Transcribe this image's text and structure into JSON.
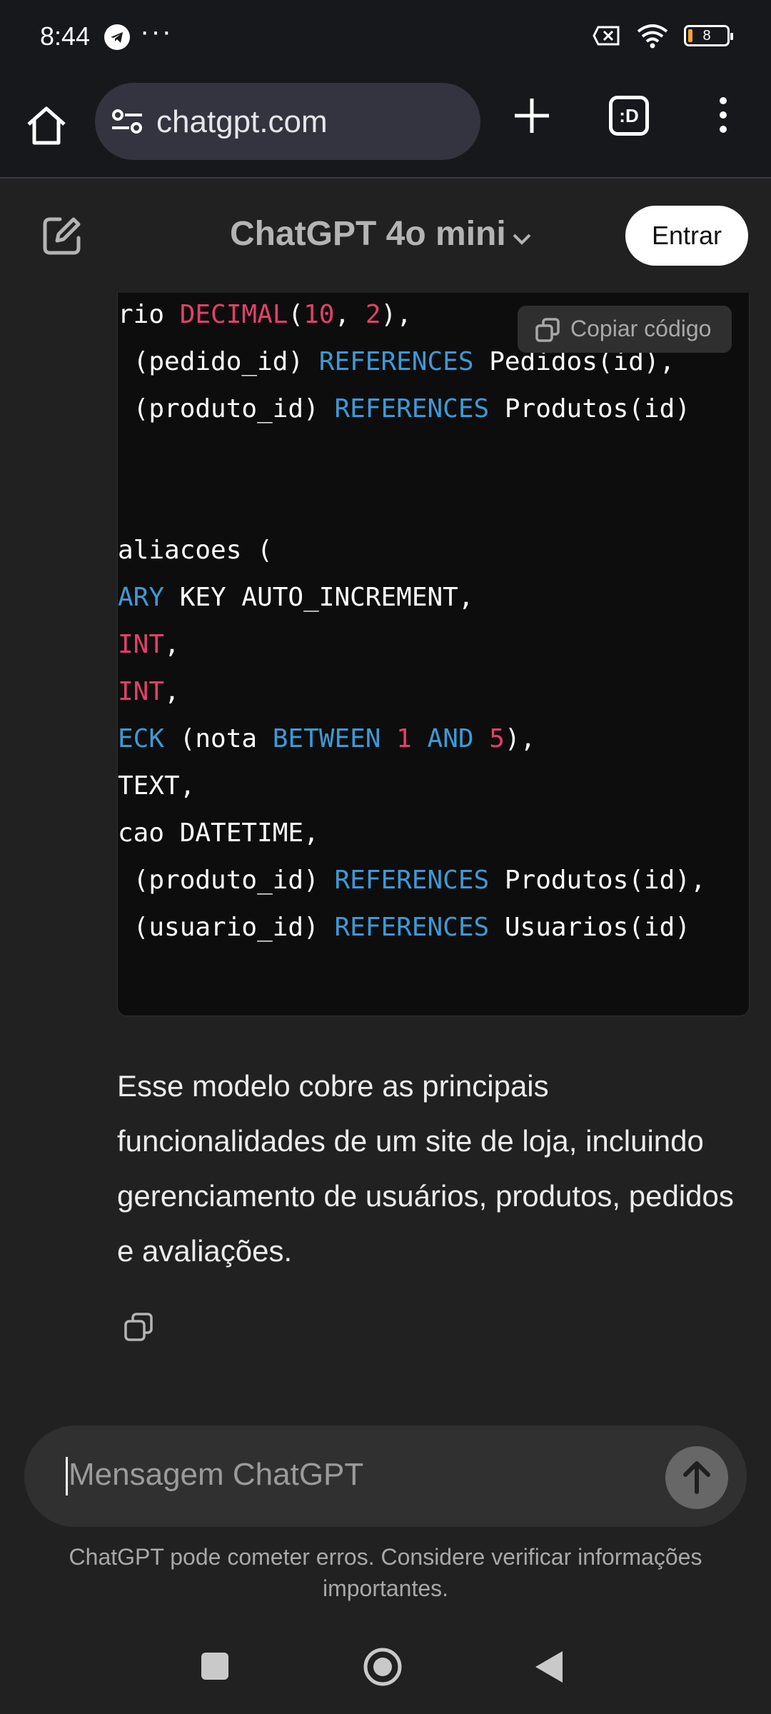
{
  "status_bar": {
    "time": "8:44",
    "dots": "···",
    "battery": "8",
    "icons": [
      "telegram-icon",
      "no-sim-icon",
      "wifi-icon",
      "battery-icon"
    ]
  },
  "browser": {
    "url": "chatgpt.com",
    "tabs_label": ":D",
    "icons": [
      "home-icon",
      "site-settings-icon",
      "new-tab-icon",
      "tabs-icon",
      "more-icon"
    ]
  },
  "header": {
    "model": "ChatGPT 4o mini",
    "login": "Entrar",
    "icons": [
      "new-chat-icon",
      "chevron-down-icon"
    ]
  },
  "code": {
    "copy_label": "Copiar código",
    "lines": [
      [
        {
          "t": "rio ",
          "c": ""
        },
        {
          "t": "DECIMAL",
          "c": "ty"
        },
        {
          "t": "(",
          "c": ""
        },
        {
          "t": "10",
          "c": "nu"
        },
        {
          "t": ", ",
          "c": ""
        },
        {
          "t": "2",
          "c": "nu"
        },
        {
          "t": "),",
          "c": ""
        }
      ],
      [
        {
          "t": " (pedido_id) ",
          "c": ""
        },
        {
          "t": "REFERENCES",
          "c": "kw"
        },
        {
          "t": " Pedidos(id),",
          "c": ""
        }
      ],
      [
        {
          "t": " (produto_id) ",
          "c": ""
        },
        {
          "t": "REFERENCES",
          "c": "kw"
        },
        {
          "t": " Produtos(id)",
          "c": ""
        }
      ],
      [],
      [],
      [
        {
          "t": "aliacoes (",
          "c": ""
        }
      ],
      [
        {
          "t": "ARY",
          "c": "kw"
        },
        {
          "t": " KEY AUTO_INCREMENT,",
          "c": ""
        }
      ],
      [
        {
          "t": "INT",
          "c": "ty"
        },
        {
          "t": ",",
          "c": ""
        }
      ],
      [
        {
          "t": "INT",
          "c": "ty"
        },
        {
          "t": ",",
          "c": ""
        }
      ],
      [
        {
          "t": "ECK",
          "c": "kw"
        },
        {
          "t": " (nota ",
          "c": ""
        },
        {
          "t": "BETWEEN",
          "c": "kw"
        },
        {
          "t": " ",
          "c": ""
        },
        {
          "t": "1",
          "c": "nu"
        },
        {
          "t": " ",
          "c": ""
        },
        {
          "t": "AND",
          "c": "kw"
        },
        {
          "t": " ",
          "c": ""
        },
        {
          "t": "5",
          "c": "nu"
        },
        {
          "t": "),",
          "c": ""
        }
      ],
      [
        {
          "t": "TEXT,",
          "c": ""
        }
      ],
      [
        {
          "t": "cao DATETIME,",
          "c": ""
        }
      ],
      [
        {
          "t": " (produto_id) ",
          "c": ""
        },
        {
          "t": "REFERENCES",
          "c": "kw"
        },
        {
          "t": " Produtos(id),",
          "c": ""
        }
      ],
      [
        {
          "t": " (usuario_id) ",
          "c": ""
        },
        {
          "t": "REFERENCES",
          "c": "kw"
        },
        {
          "t": " Usuarios(id)",
          "c": ""
        }
      ]
    ]
  },
  "message": {
    "summary": "Esse modelo cobre as principais funcionalidades de um site de loja, incluindo gerenciamento de usuários, produtos, pedidos e avaliações.",
    "copy_icon": "copy-icon"
  },
  "composer": {
    "placeholder": "Mensagem ChatGPT",
    "send_icon": "arrow-up-icon"
  },
  "disclaimer": "ChatGPT pode cometer erros. Considere verificar informações importantes.",
  "navbar": {
    "icons": [
      "recents-icon",
      "home-circle-icon",
      "back-icon"
    ]
  },
  "colors": {
    "background": "#212121",
    "code_background": "#0d0d0d",
    "keyword": "#3d9ad6",
    "type": "#e1416a"
  }
}
